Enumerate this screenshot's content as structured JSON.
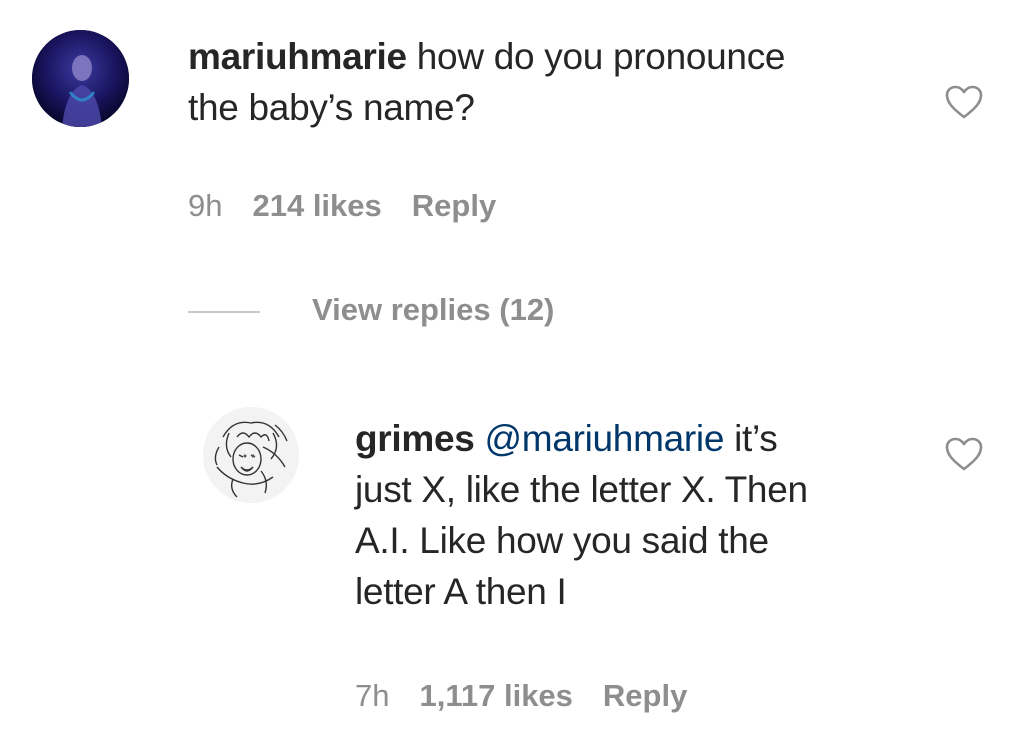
{
  "comment": {
    "username": "mariuhmarie",
    "text_line1": " how do you pronounce",
    "text_line2": "the baby’s name?",
    "time": "9h",
    "likes": "214 likes",
    "reply": "Reply",
    "avatar_icon": "user-avatar-photo",
    "like_icon": "heart-outline-icon"
  },
  "replies_toggle": {
    "label": "View replies (12)"
  },
  "reply": {
    "username": "grimes",
    "mention": "@mariuhmarie",
    "text_line1_tail": " it’s",
    "text_line2": "just X, like the letter X. Then",
    "text_line3": "A.I. Like how you said the",
    "text_line4": "letter A then I",
    "time": "7h",
    "likes": "1,117 likes",
    "reply": "Reply",
    "avatar_icon": "user-avatar-sketch",
    "like_icon": "heart-outline-icon"
  },
  "colors": {
    "text": "#262626",
    "meta": "#8e8e8e",
    "mention": "#00376b"
  }
}
